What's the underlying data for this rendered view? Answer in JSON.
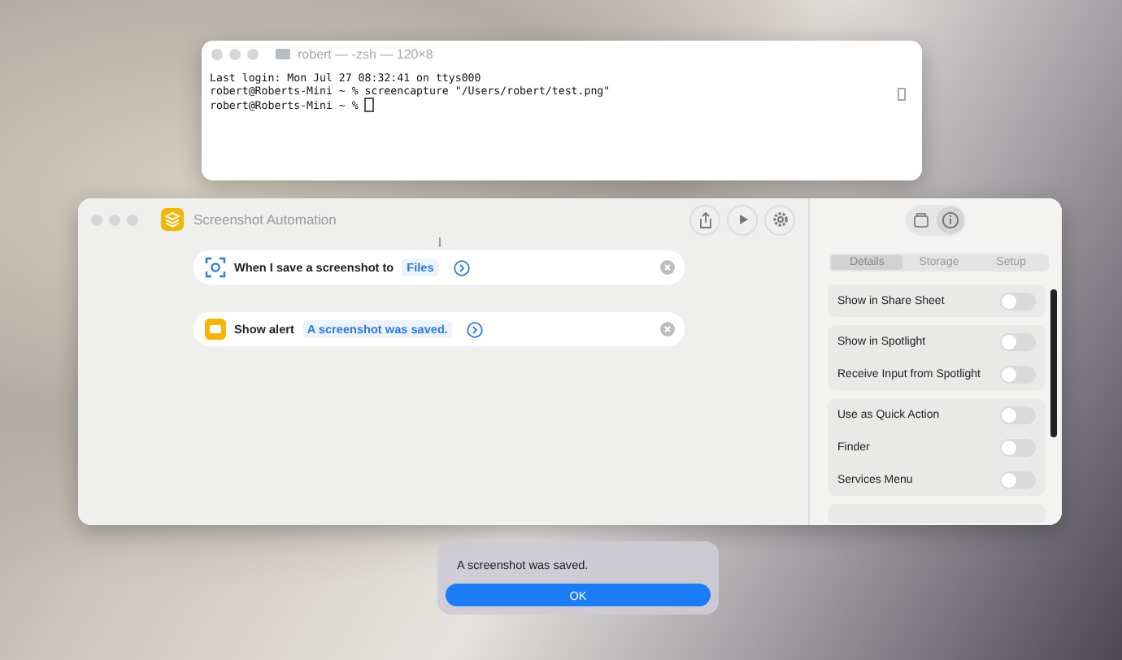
{
  "terminal": {
    "title": "robert — -zsh — 120×8",
    "lines": [
      "Last login: Mon Jul 27 08:32:41 on ttys000",
      "robert@Roberts-Mini ~ % screencapture \"/Users/robert/test.png\"",
      "robert@Roberts-Mini ~ % "
    ]
  },
  "shortcut_window": {
    "title": "Screenshot Automation",
    "actions": [
      {
        "kind": "trigger",
        "label": "When I save a screenshot to",
        "token": "Files"
      },
      {
        "kind": "alert",
        "label": "Show alert",
        "token": "A screenshot was saved."
      }
    ],
    "tabs": [
      {
        "label": "Details",
        "selected": true
      },
      {
        "label": "Storage",
        "selected": false
      },
      {
        "label": "Setup",
        "selected": false
      }
    ],
    "settings_groups": [
      [
        {
          "label": "Show in Share Sheet",
          "on": false
        }
      ],
      [
        {
          "label": "Show in Spotlight",
          "on": false
        },
        {
          "label": "Receive Input from Spotlight",
          "on": false
        }
      ],
      [
        {
          "label": "Use as Quick Action",
          "on": false
        },
        {
          "label": "Finder",
          "on": false
        },
        {
          "label": "Services Menu",
          "on": false
        }
      ]
    ]
  },
  "alert": {
    "message": "A screenshot was saved.",
    "button": "OK"
  }
}
